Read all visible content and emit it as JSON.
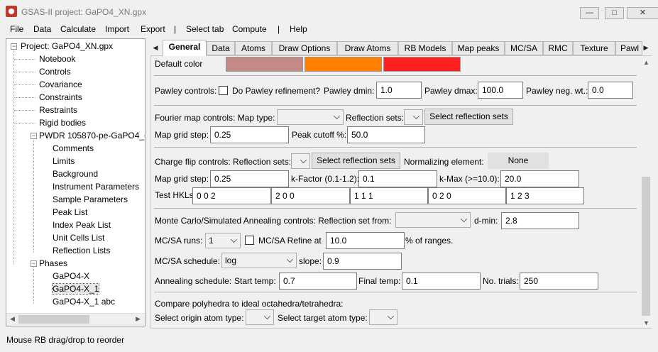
{
  "window": {
    "title": "GSAS-II project: GaPO4_XN.gpx",
    "controls": {
      "minimize": "—",
      "maximize": "□",
      "close": "✕"
    }
  },
  "menu": [
    "File",
    "Data",
    "Calculate",
    "Import",
    "Export",
    "|",
    "Select tab",
    "Compute",
    "|",
    "Help"
  ],
  "tree": {
    "root": "Project: GaPO4_XN.gpx",
    "items": [
      "Notebook",
      "Controls",
      "Covariance",
      "Constraints",
      "Restraints",
      "Rigid bodies"
    ],
    "pwdr": "PWDR 105870-pe-GaPO4_ed",
    "pwdr_items": [
      "Comments",
      "Limits",
      "Background",
      "Instrument Parameters",
      "Sample Parameters",
      "Peak List",
      "Index Peak List",
      "Unit Cells List",
      "Reflection Lists"
    ],
    "phases": "Phases",
    "phase_items": [
      "GaPO4-X",
      "GaPO4-X_1",
      "GaPO4-X_1 abc"
    ],
    "selected": "GaPO4-X_1",
    "expander": "−"
  },
  "tabs": [
    "General",
    "Data",
    "Atoms",
    "Draw Options",
    "Draw Atoms",
    "RB Models",
    "Map peaks",
    "MC/SA",
    "RMC",
    "Texture",
    "Pawl"
  ],
  "active_tab": "General",
  "scroll_arrows": {
    "left": "◀",
    "right": "▶",
    "up": "▲",
    "down": "▼"
  },
  "default_color": {
    "label": "Default color",
    "swatches": [
      "#c48a88",
      "#ff8000",
      "#ff2020"
    ]
  },
  "pawley": {
    "label": "Pawley controls:",
    "refine_label": "Do Pawley refinement?",
    "dmin_label": "Pawley dmin:",
    "dmin": "1.0",
    "dmax_label": "Pawley dmax:",
    "dmax": "100.0",
    "negwt_label": "Pawley neg. wt.:",
    "negwt": "0.0"
  },
  "fourier": {
    "label": "Fourier map controls: Map type:",
    "map_type": "",
    "refl_label": "Reflection sets:",
    "refl_value": "",
    "select_btn": "Select reflection sets",
    "grid_label": "Map grid step:",
    "grid": "0.25",
    "cutoff_label": "Peak cutoff %:",
    "cutoff": "50.0"
  },
  "charge_flip": {
    "label": "Charge flip controls: Reflection sets:",
    "refl_value": "",
    "select_btn": "Select reflection sets",
    "norm_label": "Normalizing element:",
    "norm_value": "None",
    "grid_label": "Map grid step:",
    "grid": "0.25",
    "kfactor_label": "k-Factor (0.1-1.2):",
    "kfactor": "0.1",
    "kmax_label": "k-Max (>=10.0):",
    "kmax": "20.0",
    "hkl_label": "Test HKLs:",
    "hkls": [
      "0  0  2",
      "2  0  0",
      "1  1  1",
      "0  2  0",
      "1  2  3"
    ]
  },
  "mcsa": {
    "label": "Monte Carlo/Simulated Annealing controls: Reflection set from:",
    "refl_value": "",
    "dmin_label": "d-min:",
    "dmin": "2.8",
    "runs_label": "MC/SA runs:",
    "runs": "1",
    "refine_label": "MC/SA Refine at",
    "refine_pct": "10.0",
    "ranges_label": "% of ranges.",
    "schedule_label": "MC/SA schedule:",
    "schedule": "log",
    "slope_label": "slope:",
    "slope": "0.9",
    "anneal_label": "Annealing schedule:",
    "start_label": "Start temp:",
    "start": "0.7",
    "final_label": "Final temp:",
    "final": "0.1",
    "trials_label": "No. trials:",
    "trials": "250"
  },
  "polyhedra": {
    "label": "Compare polyhedra to ideal octahedra/tetrahedra:",
    "origin_label": "Select origin atom type:",
    "origin_value": "",
    "target_label": "Select target atom type:",
    "target_value": ""
  },
  "status": "Mouse RB drag/drop to reorder"
}
